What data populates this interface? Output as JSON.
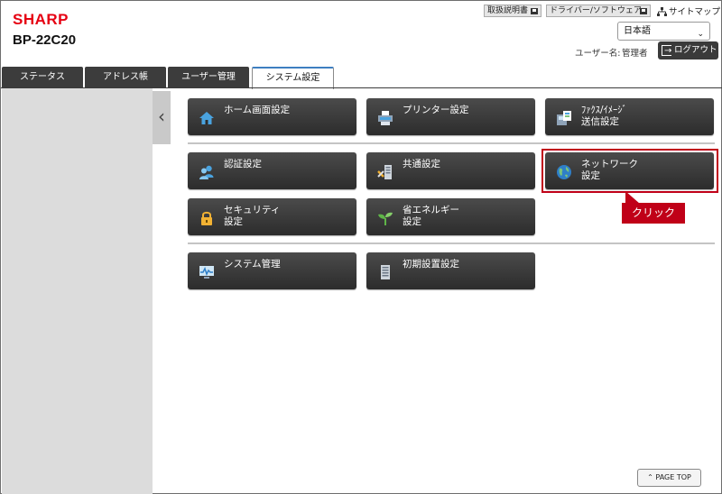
{
  "brand": {
    "logo": "SHARP",
    "model": "BP-22C20"
  },
  "top_links": {
    "manual": "取扱説明書",
    "driver": "ドライバー/ソフトウェア",
    "sitemap": "サイトマップ"
  },
  "language": {
    "selected": "日本語"
  },
  "user": {
    "label": "ユーザー名:",
    "name": "管理者"
  },
  "logout_label": "ログアウト",
  "tabs": [
    {
      "label": "ステータス"
    },
    {
      "label": "アドレス帳"
    },
    {
      "label": "ユーザー管理"
    },
    {
      "label": "システム設定",
      "active": true
    }
  ],
  "menu": {
    "home": "ホーム画面設定",
    "printer": "プリンター設定",
    "fax_image": "ﾌｧｸｽ/ｲﾒｰｼﾞ\n送信設定",
    "auth": "認証設定",
    "common": "共通設定",
    "network": "ネットワーク\n設定",
    "security": "セキュリティ\n設定",
    "energy": "省エネルギー\n設定",
    "system_mgmt": "システム管理",
    "initial": "初期設置設定"
  },
  "callout": "クリック",
  "page_top": "PAGE TOP",
  "colors": {
    "brand": "#e60012",
    "highlight": "#c00018",
    "tab_active_top": "#3e7fc1"
  }
}
